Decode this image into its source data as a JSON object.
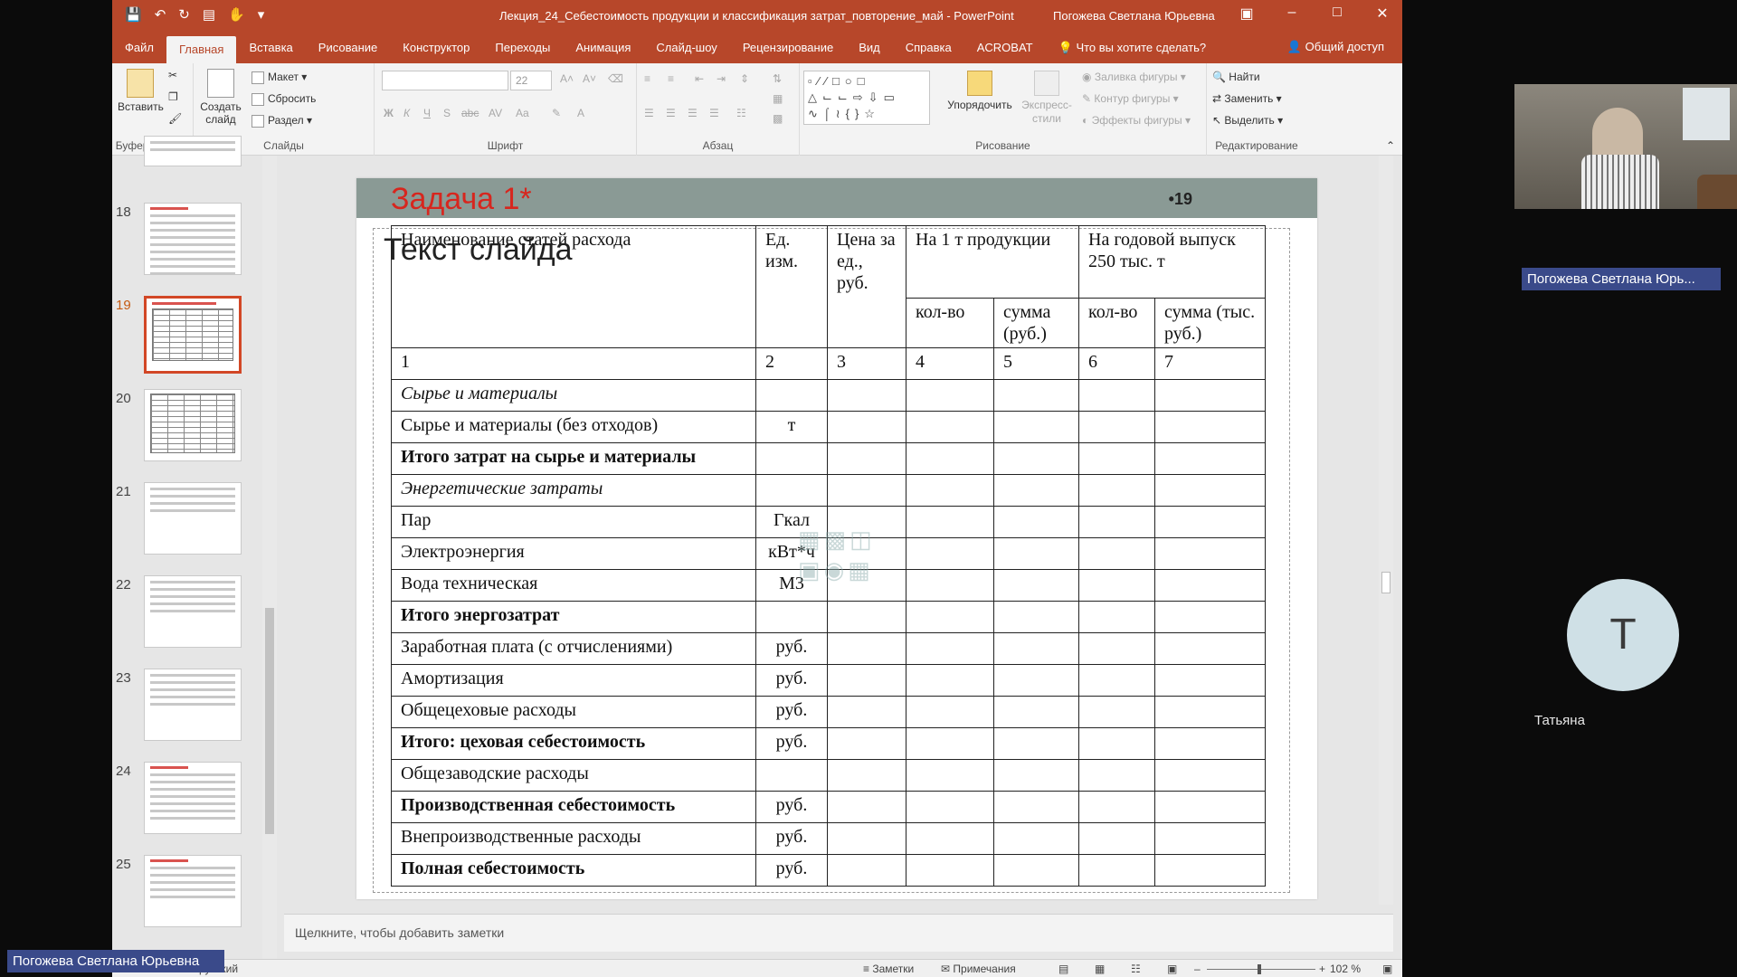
{
  "window": {
    "doc_title": "Лекция_24_Себестоимость продукции и классификация затрат_повторение_май  -  PowerPoint",
    "user_name": "Погожева Светлана Юрьевна"
  },
  "menu": {
    "tabs": [
      "Файл",
      "Главная",
      "Вставка",
      "Рисование",
      "Конструктор",
      "Переходы",
      "Анимация",
      "Слайд-шоу",
      "Рецензирование",
      "Вид",
      "Справка",
      "ACROBAT",
      "Что вы хотите сделать?"
    ],
    "share": "Общий доступ"
  },
  "ribbon": {
    "paste": "Вставить",
    "clipboard_group": "Буфер обмена",
    "new_slide": "Создать слайд",
    "layout": "Макет",
    "reset": "Сбросить",
    "section": "Раздел",
    "slides_group": "Слайды",
    "font_size": "22",
    "font_group": "Шрифт",
    "paragraph_group": "Абзац",
    "arrange": "Упорядочить",
    "quick_styles": "Экспресс-стили",
    "shape_fill": "Заливка фигуры",
    "shape_outline": "Контур фигуры",
    "shape_effects": "Эффекты фигуры",
    "drawing_group": "Рисование",
    "find": "Найти",
    "replace": "Заменить",
    "select": "Выделить",
    "editing_group": "Редактирование"
  },
  "thumbnails": [
    {
      "num": "18",
      "active": false
    },
    {
      "num": "19",
      "active": true
    },
    {
      "num": "20",
      "active": false
    },
    {
      "num": "21",
      "active": false
    },
    {
      "num": "22",
      "active": false
    },
    {
      "num": "23",
      "active": false
    },
    {
      "num": "24",
      "active": false
    },
    {
      "num": "25",
      "active": false
    }
  ],
  "slide": {
    "title": "Задача 1*",
    "number": "•19",
    "placeholder": "Текст слайда",
    "table": {
      "head": {
        "name": "Наименование статей расхода",
        "unit": "Ед. изм.",
        "price": "Цена за ед., руб.",
        "per_ton": "На 1 т продукции",
        "annual": "На годовой выпуск 250 тыс. т",
        "qty": "кол-во",
        "sum_rub": "сумма (руб.)",
        "qty2": "кол-во",
        "sum_thous": "сумма (тыс. руб.)"
      },
      "numbers": [
        "1",
        "2",
        "3",
        "4",
        "5",
        "6",
        "7"
      ],
      "rows": [
        {
          "name": "Сырье и материалы",
          "unit": "",
          "style": "italic"
        },
        {
          "name": "Сырье и материалы (без отходов)",
          "unit": "т",
          "style": "normal"
        },
        {
          "name": "Итого затрат на сырье и материалы",
          "unit": "",
          "style": "bold"
        },
        {
          "name": "Энергетические затраты",
          "unit": "",
          "style": "italic"
        },
        {
          "name": "Пар",
          "unit": "Гкал",
          "style": "normal"
        },
        {
          "name": "Электроэнергия",
          "unit": "кВт*ч",
          "style": "normal"
        },
        {
          "name": "Вода техническая",
          "unit": "М3",
          "style": "normal"
        },
        {
          "name": "Итого энергозатрат",
          "unit": "",
          "style": "bold"
        },
        {
          "name": "Заработная плата (с отчислениями)",
          "unit": "руб.",
          "style": "normal"
        },
        {
          "name": "Амортизация",
          "unit": "руб.",
          "style": "normal"
        },
        {
          "name": "Общецеховые расходы",
          "unit": "руб.",
          "style": "normal"
        },
        {
          "name": "Итого: цеховая себестоимость",
          "unit": "руб.",
          "style": "bold"
        },
        {
          "name": "Общезаводские расходы",
          "unit": "",
          "style": "normal"
        },
        {
          "name": "Производственная себестоимость",
          "unit": "руб.",
          "style": "bold"
        },
        {
          "name": "Внепроизводственные расходы",
          "unit": "руб.",
          "style": "normal"
        },
        {
          "name": "Полная себестоимость",
          "unit": "руб.",
          "style": "bold"
        }
      ]
    }
  },
  "notes_placeholder": "Щелкните, чтобы добавить заметки",
  "status": {
    "language": "русский",
    "notes": "Заметки",
    "comments": "Примечания",
    "zoom": "102 %"
  },
  "call": {
    "speaker_label": "Погожева Светлана Юрь...",
    "presenter_label": "Погожева Светлана Юрьевна",
    "participant_initial": "Т",
    "participant_name": "Татьяна"
  }
}
